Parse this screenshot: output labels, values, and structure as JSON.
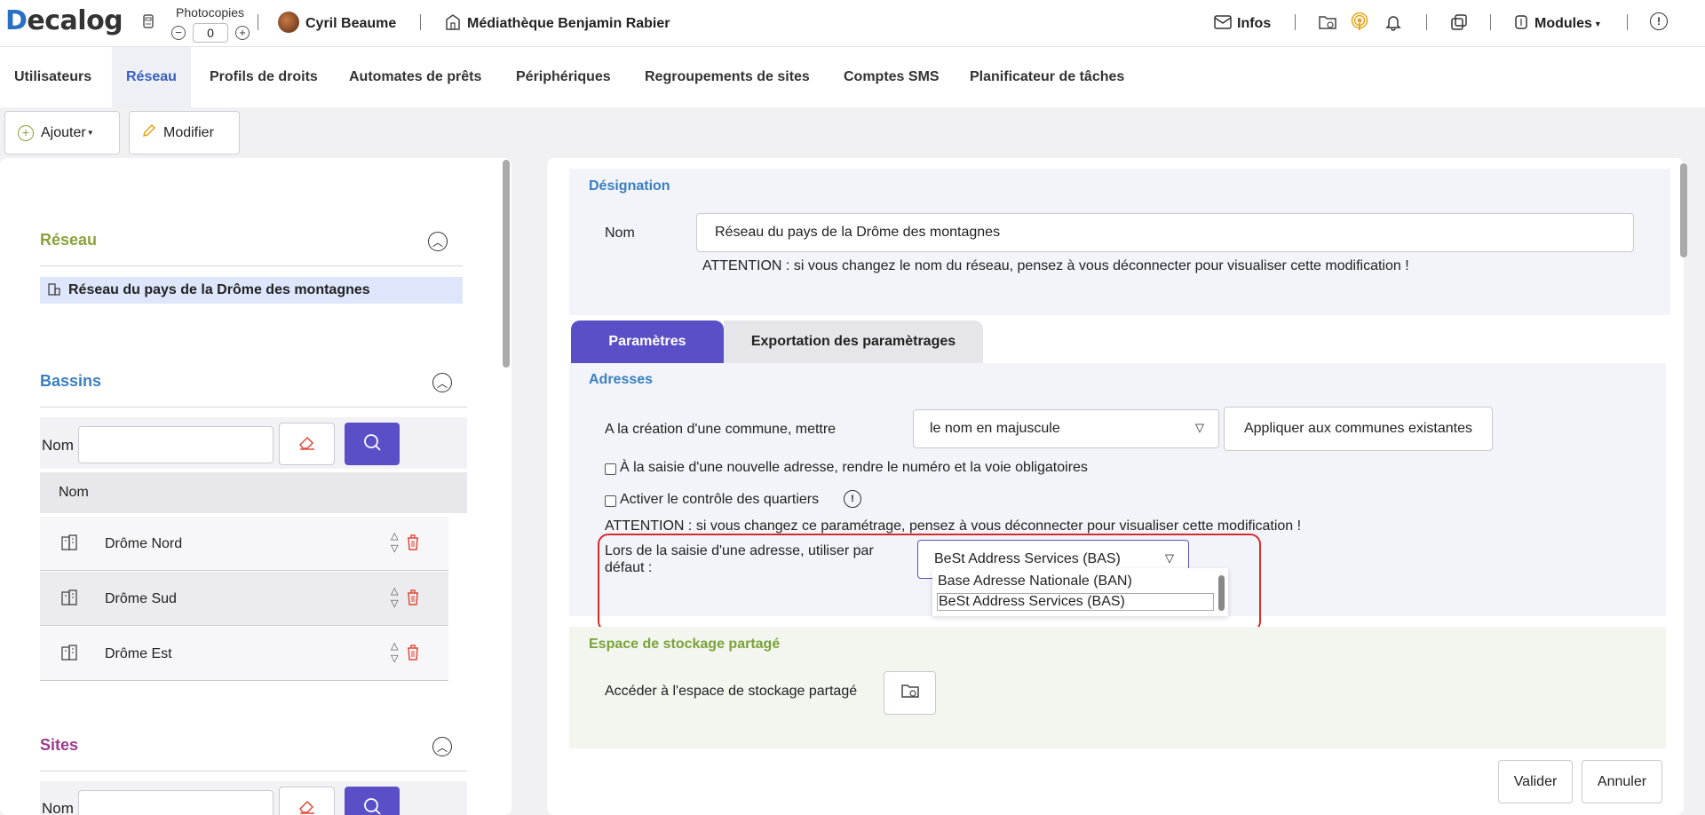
{
  "topbar": {
    "logo": "Decalog",
    "photocopies_label": "Photocopies",
    "photocopies_value": "0",
    "user_name": "Cyril Beaume",
    "library_name": "Médiathèque Benjamin Rabier",
    "infos_label": "Infos",
    "modules_label": "Modules"
  },
  "nav": {
    "tabs": [
      {
        "label": "Utilisateurs"
      },
      {
        "label": "Réseau"
      },
      {
        "label": "Profils de droits"
      },
      {
        "label": "Automates de prêts"
      },
      {
        "label": "Périphériques"
      },
      {
        "label": "Regroupements de sites"
      },
      {
        "label": "Comptes SMS"
      },
      {
        "label": "Planificateur de tâches"
      }
    ]
  },
  "toolbar": {
    "add_label": "Ajouter",
    "edit_label": "Modifier"
  },
  "left": {
    "reseau": {
      "title": "Réseau",
      "item": "Réseau du pays de la Drôme des montagnes"
    },
    "bassins": {
      "title": "Bassins",
      "filter_label": "Nom",
      "column_header": "Nom",
      "rows": [
        {
          "name": "Drôme Nord"
        },
        {
          "name": "Drôme Sud"
        },
        {
          "name": "Drôme Est"
        }
      ]
    },
    "sites": {
      "title": "Sites",
      "filter_label": "Nom"
    }
  },
  "right": {
    "designation": {
      "title": "Désignation",
      "name_label": "Nom",
      "name_value": "Réseau du pays de la Drôme des montagnes",
      "warning": "ATTENTION : si vous changez le nom du réseau, pensez à vous déconnecter pour visualiser cette modification !"
    },
    "tabs": [
      {
        "label": "Paramètres"
      },
      {
        "label": "Exportation des paramètrages"
      }
    ],
    "adresses": {
      "title": "Adresses",
      "commune_label": "A la création d'une commune, mettre",
      "commune_value": "le nom en majuscule",
      "apply_button": "Appliquer aux communes existantes",
      "checkbox1": "À la saisie d'une nouvelle adresse, rendre le numéro et la voie obligatoires",
      "checkbox2": "Activer le contrôle des quartiers",
      "warning": "ATTENTION : si vous changez ce paramétrage, pensez à vous déconnecter pour visualiser cette modification !",
      "default_label": "Lors de la saisie d'une adresse, utiliser par défaut :",
      "default_value": "BeSt Address Services (BAS)",
      "options": [
        {
          "label": "Base Adresse Nationale (BAN)"
        },
        {
          "label": "BeSt Address Services (BAS)"
        }
      ]
    },
    "storage": {
      "title": "Espace de stockage partagé",
      "access_label": "Accéder à l'espace de stockage partagé"
    },
    "footer": {
      "validate": "Valider",
      "cancel": "Annuler"
    }
  },
  "colors": {
    "reseau_title": "#8aa23a",
    "bassins_title": "#3a7fc1",
    "sites_title": "#9b3b8e",
    "designation_title": "#3a7fc1",
    "storage_title": "#7aa23a",
    "accent_purple": "#5b4fc7",
    "highlight_red": "#d42b2b"
  }
}
